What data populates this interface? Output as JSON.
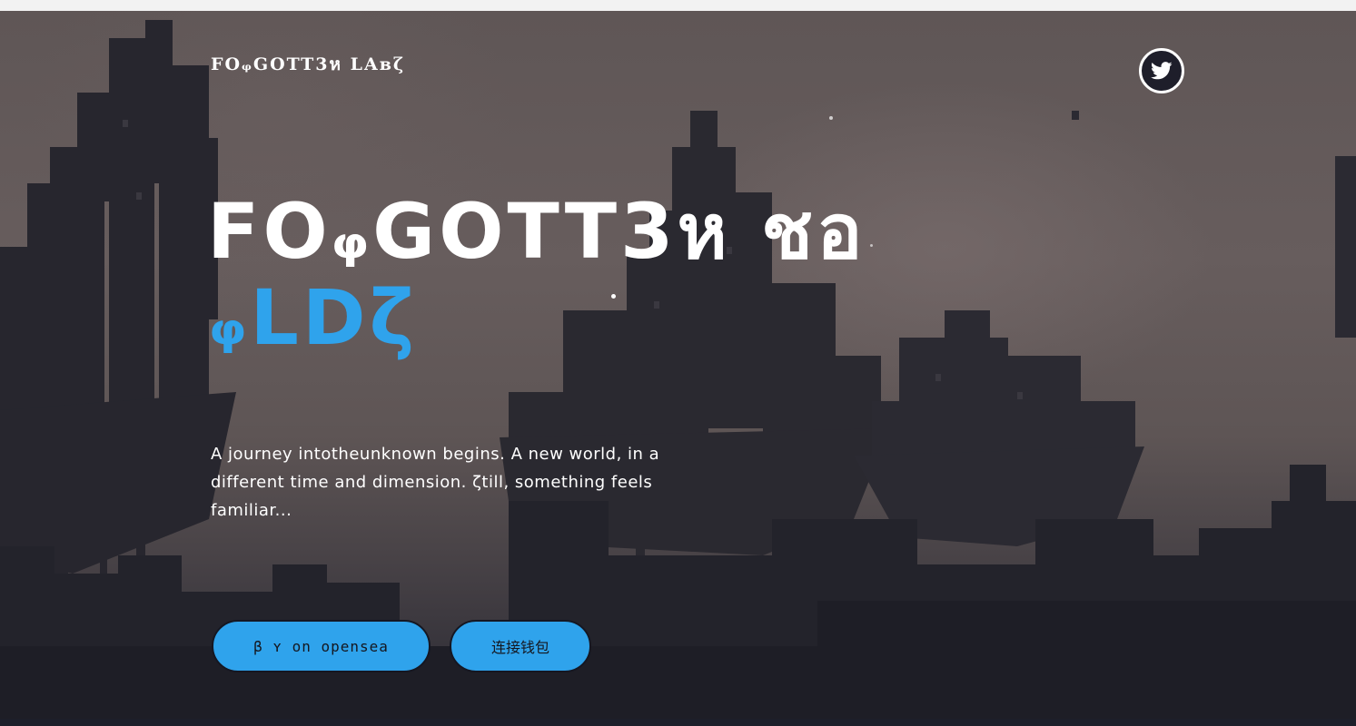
{
  "header": {
    "brand": "FOᵩGOTT3ห LAʙζ",
    "twitter_icon": "twitter-bird-icon"
  },
  "hero": {
    "title_line1": "FOᵩGOTT3ห ชอ",
    "title_line2": "ᵩLDζ",
    "tagline": "A journey intotheunknown begins. A new world, in a different time and dimension. ζtill, something feels familiar...",
    "buttons": {
      "opensea_label": "β ʏ on opensea",
      "wallet_label": "连接钱包"
    }
  },
  "colors": {
    "accent": "#2fa3ec",
    "text": "#ffffff",
    "button_text": "#15171f",
    "background_dark": "#1d1f2a"
  }
}
